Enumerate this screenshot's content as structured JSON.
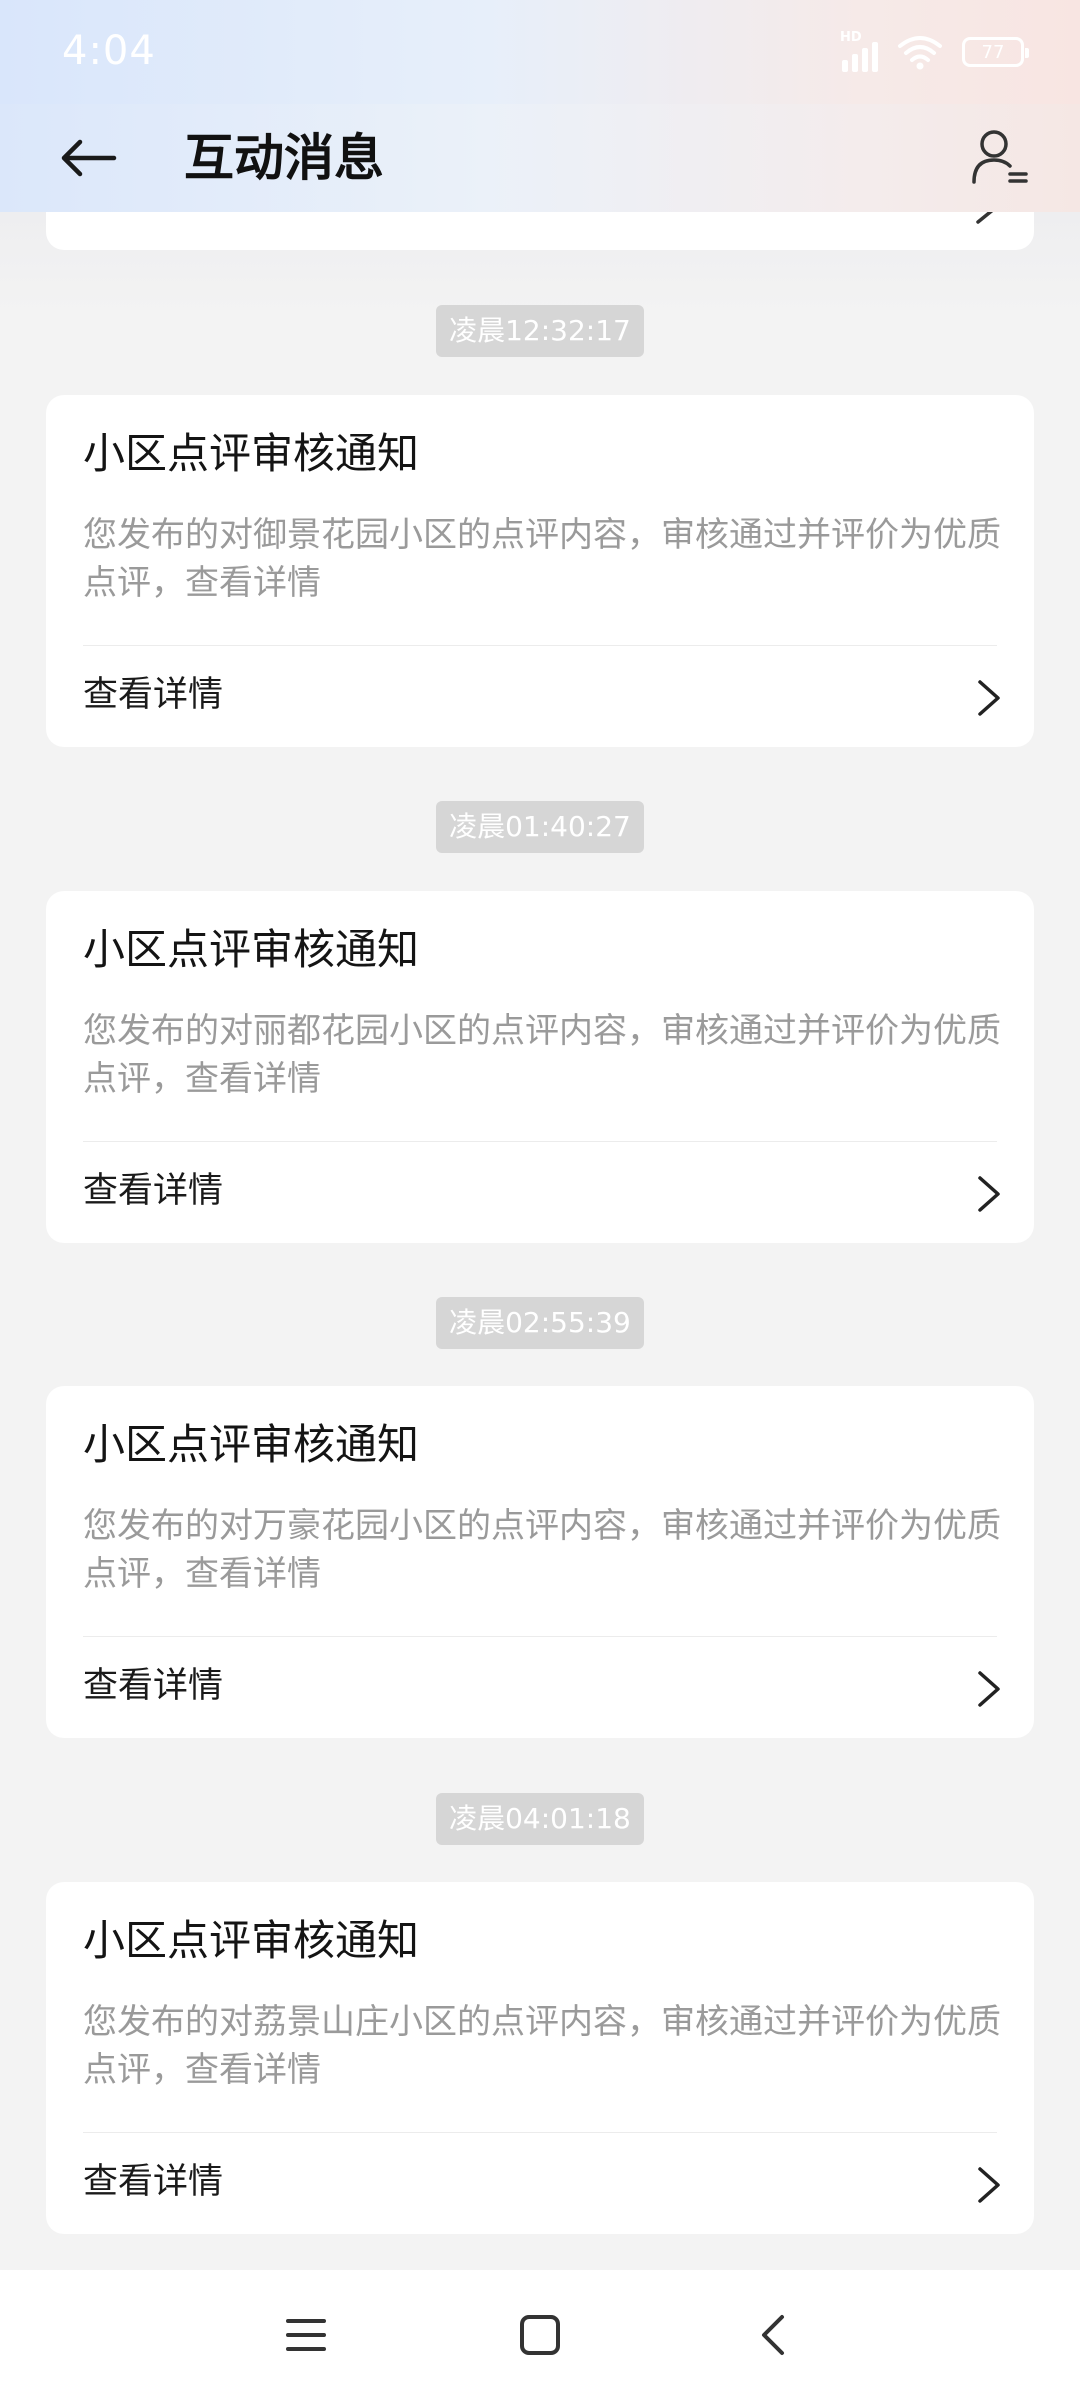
{
  "status_bar": {
    "time": "4:04",
    "network_badge": "HD",
    "battery_level": "77",
    "icons": [
      "signal-icon",
      "wifi-icon",
      "battery-icon"
    ]
  },
  "header": {
    "title": "互动消息",
    "back_icon": "arrow-left-icon",
    "profile_icon": "user-list-icon"
  },
  "messages": [
    {
      "timestamp": "凌晨12:32:17",
      "title": "小区点评审核通知",
      "body": "您发布的对御景花园小区的点评内容，审核通过并评价为优质点评，查看详情",
      "action": "查看详情"
    },
    {
      "timestamp": "凌晨01:40:27",
      "title": "小区点评审核通知",
      "body": "您发布的对丽都花园小区的点评内容，审核通过并评价为优质点评，查看详情",
      "action": "查看详情"
    },
    {
      "timestamp": "凌晨02:55:39",
      "title": "小区点评审核通知",
      "body": "您发布的对万豪花园小区的点评内容，审核通过并评价为优质点评，查看详情",
      "action": "查看详情"
    },
    {
      "timestamp": "凌晨04:01:18",
      "title": "小区点评审核通知",
      "body": "您发布的对荔景山庄小区的点评内容，审核通过并评价为优质点评，查看详情",
      "action": "查看详情"
    }
  ],
  "nav_bar": {
    "icons": [
      "menu-icon",
      "home-icon",
      "back-icon"
    ]
  },
  "colors": {
    "background": "#f3f3f3",
    "card": "#ffffff",
    "timestamp_bg": "#d6d6d6",
    "secondary_text": "#9a9a9a"
  }
}
